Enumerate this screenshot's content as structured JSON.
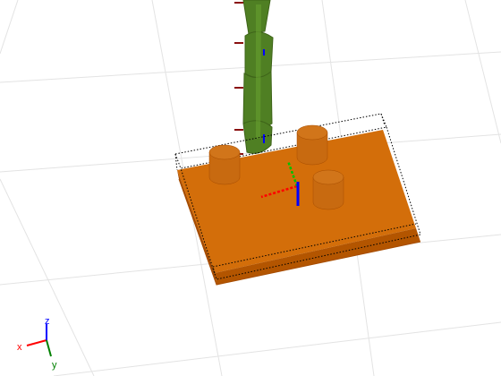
{
  "scene": {
    "background": "#ffffff",
    "grid_color": "#e3e3e3",
    "base_color": "#d06c08",
    "base_top_color": "#d36e0a",
    "base_side_color": "#a64c00",
    "base_front_color": "#b35500",
    "cylinder_color": "#c86a10",
    "cylinder_top_color": "#d1751a",
    "robot_color": "#4f7f23",
    "robot_dark_color": "#3e6419",
    "robot_light_color": "#6aa232",
    "bbox_line_color": "#000000",
    "frame_x_color": "#ff0000",
    "frame_y_color": "#00c000",
    "frame_z_color": "#0000ff",
    "joint_marker_color": "#8a1010"
  },
  "orientation_axes": {
    "x_label": "x",
    "y_label": "y",
    "z_label": "z",
    "x_color": "#ff0000",
    "y_color": "#008000",
    "z_color": "#0000ff"
  }
}
